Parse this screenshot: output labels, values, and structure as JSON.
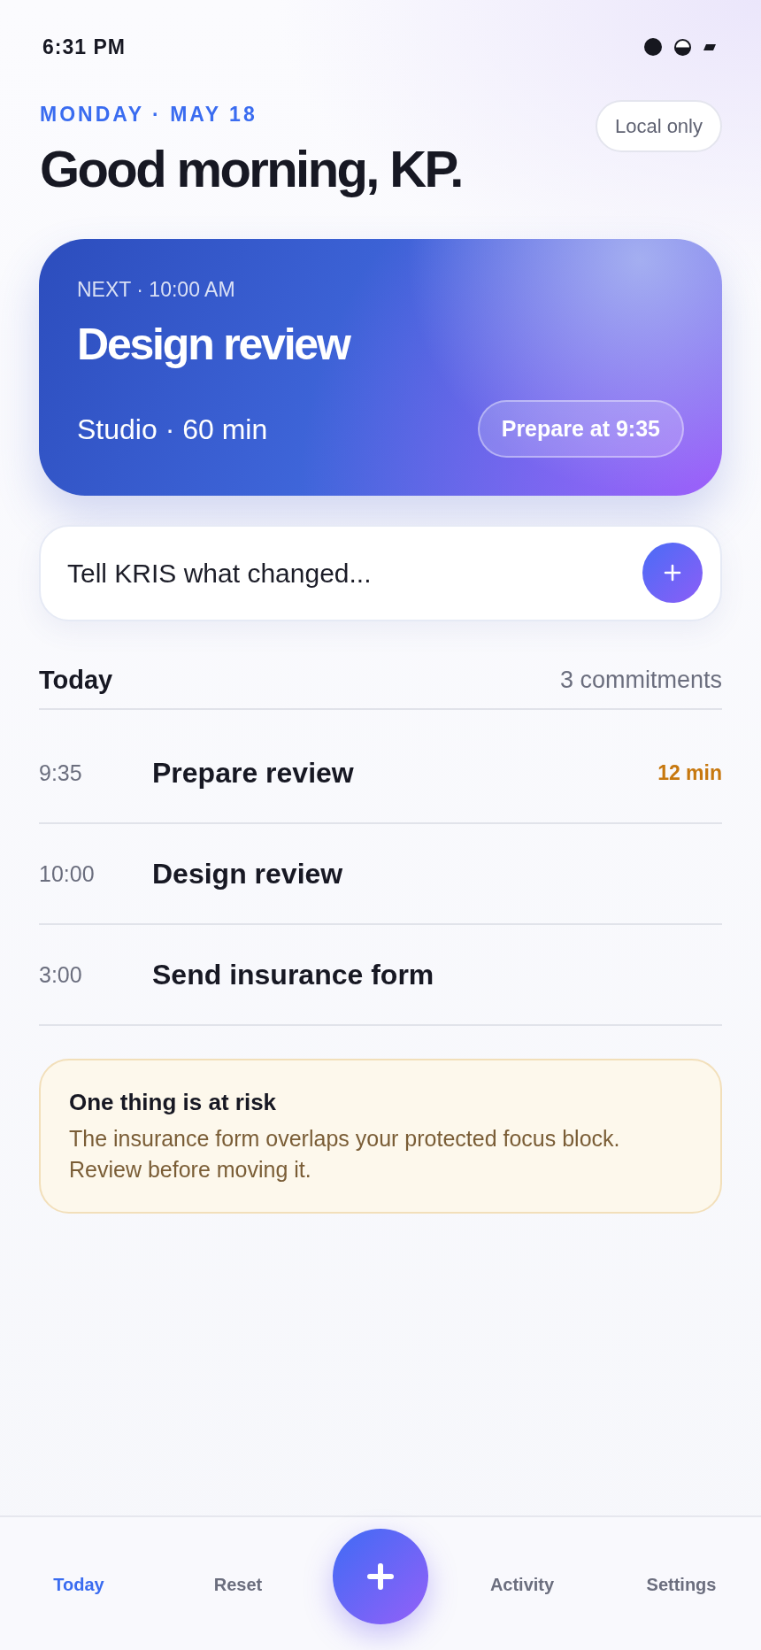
{
  "status_bar": {
    "time": "6:31 PM"
  },
  "header": {
    "date": "MONDAY · MAY 18",
    "greeting": "Good morning, KP.",
    "badge": "Local only"
  },
  "next_card": {
    "label": "NEXT · 10:00 AM",
    "title": "Design review",
    "details": "Studio · 60 min",
    "action": "Prepare at 9:35"
  },
  "composer": {
    "placeholder": "Tell KRIS what changed..."
  },
  "today": {
    "title": "Today",
    "count": "3 commitments",
    "items": [
      {
        "time": "9:35",
        "title": "Prepare review",
        "note": "12 min"
      },
      {
        "time": "10:00",
        "title": "Design review"
      },
      {
        "time": "3:00",
        "title": "Send insurance form"
      }
    ]
  },
  "alert": {
    "title": "One thing is at risk",
    "message": "The insurance form overlaps your protected focus block. Review before moving it."
  },
  "nav": {
    "tabs": [
      {
        "label": "Today",
        "selected": true
      },
      {
        "label": "Reset",
        "selected": false
      },
      {
        "label": "Activity",
        "selected": false
      },
      {
        "label": "Settings",
        "selected": false
      }
    ]
  }
}
